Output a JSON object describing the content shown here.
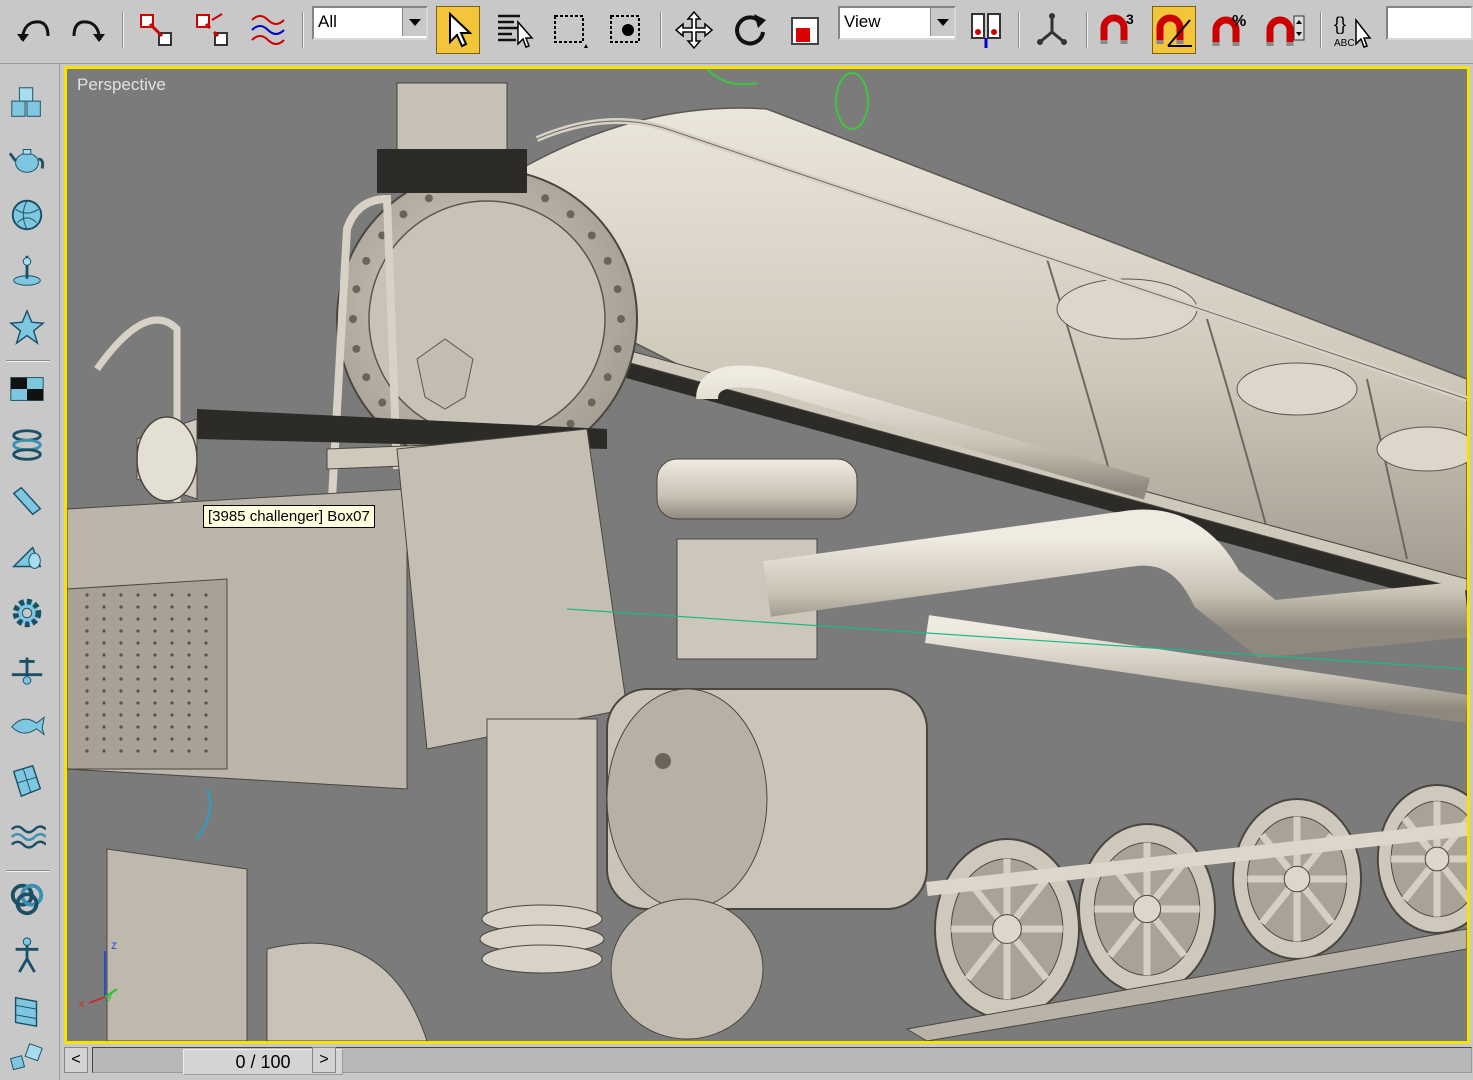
{
  "toolbar": {
    "buttons": [
      {
        "name": "undo",
        "icon": "undo-icon"
      },
      {
        "name": "redo",
        "icon": "redo-icon"
      },
      {
        "name": "select-and-link",
        "icon": "link-icon"
      },
      {
        "name": "unlink-selection",
        "icon": "unlink-icon"
      },
      {
        "name": "bind-to-space-warp",
        "icon": "bind-space-warp-icon"
      },
      {
        "name": "select-object",
        "icon": "arrow-cursor-icon",
        "active": true
      },
      {
        "name": "select-by-name",
        "icon": "select-by-name-icon"
      },
      {
        "name": "rectangular-selection-region",
        "icon": "rectangle-selection-icon"
      },
      {
        "name": "window-crossing",
        "icon": "window-crossing-icon"
      },
      {
        "name": "select-and-move",
        "icon": "move-icon"
      },
      {
        "name": "select-and-rotate",
        "icon": "rotate-icon"
      },
      {
        "name": "select-and-scale",
        "icon": "scale-icon"
      },
      {
        "name": "use-pivot-point-center",
        "icon": "pivot-center-icon"
      },
      {
        "name": "select-and-manipulate",
        "icon": "manipulate-icon"
      },
      {
        "name": "snaps-toggle",
        "icon": "snap-magnet-icon",
        "badge": "3"
      },
      {
        "name": "angle-snap-toggle",
        "icon": "angle-snap-icon",
        "active": true
      },
      {
        "name": "percent-snap-toggle",
        "icon": "percent-snap-icon",
        "badge": "%"
      },
      {
        "name": "spinner-snap-toggle",
        "icon": "spinner-snap-icon"
      },
      {
        "name": "edit-named-selection-sets",
        "icon": "named-selection-icon",
        "badge": "ABC"
      }
    ],
    "selection_filter": "All",
    "reference_coordinate_system": "View"
  },
  "command_panel": {
    "items": [
      {
        "name": "create-geometry",
        "icon": "boxes-icon"
      },
      {
        "name": "teapot",
        "icon": "teapot-icon"
      },
      {
        "name": "sphere",
        "icon": "sphere-icon"
      },
      {
        "name": "light",
        "icon": "light-icon"
      },
      {
        "name": "helpers",
        "icon": "star-figure-icon"
      },
      {
        "name": "materials",
        "icon": "checker-icon"
      },
      {
        "name": "spring",
        "icon": "spring-icon"
      },
      {
        "name": "cylinder",
        "icon": "cylinder-icon"
      },
      {
        "name": "cone",
        "icon": "cone-icon"
      },
      {
        "name": "gear",
        "icon": "gear-icon"
      },
      {
        "name": "tool",
        "icon": "tool-icon"
      },
      {
        "name": "fish",
        "icon": "fish-icon"
      },
      {
        "name": "patch",
        "icon": "patch-icon"
      },
      {
        "name": "waves",
        "icon": "waves-icon"
      },
      {
        "name": "knot",
        "icon": "knot-icon"
      },
      {
        "name": "biped",
        "icon": "biped-icon"
      },
      {
        "name": "panel",
        "icon": "panel-icon"
      },
      {
        "name": "cubes",
        "icon": "cubes-icon"
      }
    ]
  },
  "viewport": {
    "label": "Perspective",
    "tooltip": "[3985 challenger] Box07",
    "axis": {
      "z": "z",
      "y": "y",
      "x": "x"
    },
    "border_color": "#f5e400",
    "background": "#7b7b7b",
    "model_color": "#d2cdc2"
  },
  "time_slider": {
    "frame_label": "0 / 100",
    "prev_label": "<",
    "next_label": ">"
  }
}
